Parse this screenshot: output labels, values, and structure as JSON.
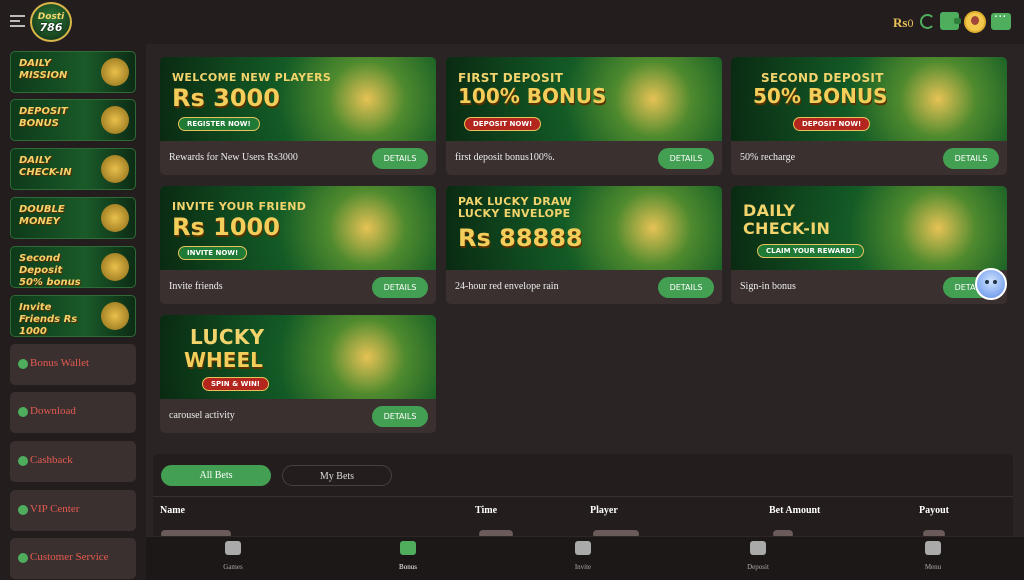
{
  "header": {
    "logo_line1": "Dosti",
    "logo_line2": "786",
    "currency": "Rs",
    "balance": "0"
  },
  "sidebar": {
    "promos": [
      {
        "label": "DAILY MISSION"
      },
      {
        "label": "DEPOSIT BONUS"
      },
      {
        "label": "DAILY CHECK-IN"
      },
      {
        "label": "DOUBLE MONEY"
      },
      {
        "label": "Second Deposit 50% bonus"
      },
      {
        "label": "Invite Friends Rs 1000"
      }
    ],
    "nav": [
      {
        "label": "Bonus Wallet",
        "icon": "wallet-icon"
      },
      {
        "label": "Download",
        "icon": "cloud-download-icon"
      },
      {
        "label": "Cashback",
        "icon": "cashback-icon"
      },
      {
        "label": "VIP Center",
        "icon": "user-icon"
      },
      {
        "label": "Customer Service",
        "icon": "support-icon"
      }
    ]
  },
  "cards": [
    {
      "banner_line1": "WELCOME NEW PLAYERS",
      "banner_line2": "Rs 3000",
      "banner_button": "REGISTER NOW!",
      "title": "Rewards for New Users Rs3000",
      "details": "DETAILS"
    },
    {
      "banner_line1": "FIRST DEPOSIT",
      "banner_line2": "100% BONUS",
      "banner_button": "DEPOSIT NOW!",
      "title": "first deposit bonus100%.",
      "details": "DETAILS"
    },
    {
      "banner_line1": "SECOND DEPOSIT",
      "banner_line2": "50% BONUS",
      "banner_button": "DEPOSIT NOW!",
      "title": "50% recharge",
      "details": "DETAILS"
    },
    {
      "banner_line1": "INVITE YOUR FRIEND",
      "banner_line2": "Rs 1000",
      "banner_button": "INVITE NOW!",
      "title": "Invite friends",
      "details": "DETAILS"
    },
    {
      "banner_line1": "PAK LUCKY DRAW LUCKY ENVELOPE",
      "banner_line2": "Rs 88888",
      "banner_button": "",
      "title": "24-hour red envelope rain",
      "details": "DETAILS"
    },
    {
      "banner_line1": "DAILY CHECK-IN",
      "banner_line2": "",
      "banner_button": "CLAIM YOUR REWARD!",
      "title": "Sign-in bonus",
      "details": "DETAILS"
    },
    {
      "banner_line1": "LUCKY",
      "banner_line2": "WHEEL",
      "banner_button": "SPIN & WIN!",
      "title": "carousel activity",
      "details": "DETAILS"
    }
  ],
  "bets": {
    "tabs": [
      "All Bets",
      "My Bets"
    ],
    "columns": [
      "Name",
      "Time",
      "Player",
      "Bet Amount",
      "Payout"
    ]
  },
  "bottom_nav": [
    {
      "label": "Games",
      "icon": "gamepad-icon"
    },
    {
      "label": "Bonus",
      "icon": "gift-icon",
      "active": true
    },
    {
      "label": "Invite",
      "icon": "invite-icon"
    },
    {
      "label": "Deposit",
      "icon": "money-bag-icon"
    },
    {
      "label": "Menu",
      "icon": "hamburger-icon"
    }
  ],
  "colors": {
    "background": "#2b2424",
    "panel": "#3a3030",
    "accent_green": "#43a052",
    "gold": "#e8c259",
    "sidebar_text": "#e55a4f"
  }
}
